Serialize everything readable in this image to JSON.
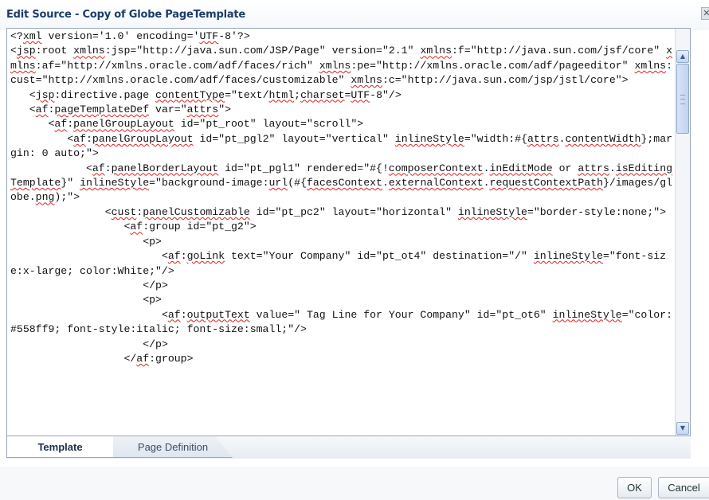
{
  "dialog": {
    "title": "Edit Source - Copy of Globe PageTemplate",
    "close_glyph": "✕"
  },
  "editor": {
    "code_lines": [
      [
        {
          "t": "<?"
        },
        {
          "t": "xml",
          "e": true
        },
        {
          "t": " version='1.0' encoding='"
        },
        {
          "t": "UTF",
          "e": true
        },
        {
          "t": "-8'?>"
        }
      ],
      [
        {
          "t": "<"
        },
        {
          "t": "jsp",
          "e": true
        },
        {
          "t": ":root "
        },
        {
          "t": "xmlns",
          "e": true
        },
        {
          "t": ":jsp=\"http://java.sun.com/JSP/Page\" version=\"2.1\" "
        },
        {
          "t": "xmlns",
          "e": true
        },
        {
          "t": ":f=\"http://java.sun.com/jsf/core\" "
        },
        {
          "t": "xmlns",
          "e": true
        },
        {
          "t": ":af=\"http://xmlns.oracle.com/adf/faces/rich\" "
        },
        {
          "t": "xmlns",
          "e": true
        },
        {
          "t": ":pe=\"http://xmlns.oracle.com/adf/pageeditor\" "
        },
        {
          "t": "xmlns",
          "e": true
        },
        {
          "t": ":cust=\"http://xmlns.oracle.com/adf/faces/customizable\" "
        },
        {
          "t": "xmlns",
          "e": true
        },
        {
          "t": ":c=\"http://java.sun.com/jsp/jstl/core\">"
        }
      ],
      [
        {
          "t": "   <"
        },
        {
          "t": "jsp",
          "e": true
        },
        {
          "t": ":directive.page "
        },
        {
          "t": "contentType",
          "e": true
        },
        {
          "t": "=\"text/"
        },
        {
          "t": "html",
          "e": true
        },
        {
          "t": ";"
        },
        {
          "t": "charset",
          "e": true
        },
        {
          "t": "="
        },
        {
          "t": "UTF",
          "e": true
        },
        {
          "t": "-8\"/>"
        }
      ],
      [
        {
          "t": "   <"
        },
        {
          "t": "af",
          "e": true
        },
        {
          "t": ":"
        },
        {
          "t": "pageTemplateDef",
          "e": true
        },
        {
          "t": " var=\""
        },
        {
          "t": "attrs",
          "e": true
        },
        {
          "t": "\">"
        }
      ],
      [
        {
          "t": "      <"
        },
        {
          "t": "af",
          "e": true
        },
        {
          "t": ":"
        },
        {
          "t": "panelGroupLayout",
          "e": true
        },
        {
          "t": " id=\"pt_root\" layout=\"scroll\">"
        }
      ],
      [
        {
          "t": "         <"
        },
        {
          "t": "af",
          "e": true
        },
        {
          "t": ":"
        },
        {
          "t": "panelGroupLayout",
          "e": true
        },
        {
          "t": " id=\"pt_pgl2\" layout=\"vertical\" "
        },
        {
          "t": "inlineStyle",
          "e": true
        },
        {
          "t": "=\"width:#{"
        },
        {
          "t": "attrs",
          "e": true
        },
        {
          "t": "."
        },
        {
          "t": "contentWidth",
          "e": true
        },
        {
          "t": "};margin: 0 auto;\">"
        }
      ],
      [
        {
          "t": "            <"
        },
        {
          "t": "af",
          "e": true
        },
        {
          "t": ":"
        },
        {
          "t": "panelBorderLayout",
          "e": true
        },
        {
          "t": " id=\"pt_pgl1\" rendered=\"#{!"
        },
        {
          "t": "composerContext",
          "e": true
        },
        {
          "t": "."
        },
        {
          "t": "inEditMode",
          "e": true
        },
        {
          "t": " or "
        },
        {
          "t": "attrs",
          "e": true
        },
        {
          "t": "."
        },
        {
          "t": "isEditingTemplate",
          "e": true
        },
        {
          "t": "}\" "
        },
        {
          "t": "inlineStyle",
          "e": true
        },
        {
          "t": "=\"background-image:"
        },
        {
          "t": "url",
          "e": true
        },
        {
          "t": "(#{"
        },
        {
          "t": "facesContext",
          "e": true
        },
        {
          "t": "."
        },
        {
          "t": "externalContext",
          "e": true
        },
        {
          "t": "."
        },
        {
          "t": "requestContextPath",
          "e": true
        },
        {
          "t": "}/images/globe."
        },
        {
          "t": "png",
          "e": true
        },
        {
          "t": ");\">"
        }
      ],
      [
        {
          "t": "               <"
        },
        {
          "t": "cust",
          "e": true
        },
        {
          "t": ":"
        },
        {
          "t": "panelCustomizable",
          "e": true
        },
        {
          "t": " id=\"pt_pc2\" layout=\"horizontal\" "
        },
        {
          "t": "inlineStyle",
          "e": true
        },
        {
          "t": "=\"border-style:none;\">"
        }
      ],
      [
        {
          "t": "                  <"
        },
        {
          "t": "af",
          "e": true
        },
        {
          "t": ":group id=\"pt_g2\">"
        }
      ],
      [
        {
          "t": "                     <p>"
        }
      ],
      [
        {
          "t": "                        <"
        },
        {
          "t": "af",
          "e": true
        },
        {
          "t": ":"
        },
        {
          "t": "goLink",
          "e": true
        },
        {
          "t": " text=\"Your Company\" id=\"pt_ot4\" destination=\"/\" "
        },
        {
          "t": "inlineStyle",
          "e": true
        },
        {
          "t": "=\"font-size:x-large; color:White;\"/>"
        }
      ],
      [
        {
          "t": "                     </p>"
        }
      ],
      [
        {
          "t": "                     <p>"
        }
      ],
      [
        {
          "t": "                        <"
        },
        {
          "t": "af",
          "e": true
        },
        {
          "t": ":"
        },
        {
          "t": "outputText",
          "e": true
        },
        {
          "t": " value=\" Tag Line for Your Company\" id=\"pt_ot6\" "
        },
        {
          "t": "inlineStyle",
          "e": true
        },
        {
          "t": "=\"color:#558ff9; font-style:italic; font-size:small;\"/>"
        }
      ],
      [
        {
          "t": "                     </p>"
        }
      ],
      [
        {
          "t": "                  </"
        },
        {
          "t": "af",
          "e": true
        },
        {
          "t": ":group>"
        }
      ]
    ],
    "scroll_up_glyph": "▲",
    "scroll_down_glyph": "▼"
  },
  "tabs": [
    {
      "label": "Template",
      "active": true
    },
    {
      "label": "Page Definition",
      "active": false
    }
  ],
  "buttons": {
    "ok_label": "OK",
    "cancel_label": "Cancel"
  },
  "colors": {
    "title_text": "#1c3c6c",
    "spell_error_underline": "#e02020",
    "border": "#9aa6b4"
  }
}
